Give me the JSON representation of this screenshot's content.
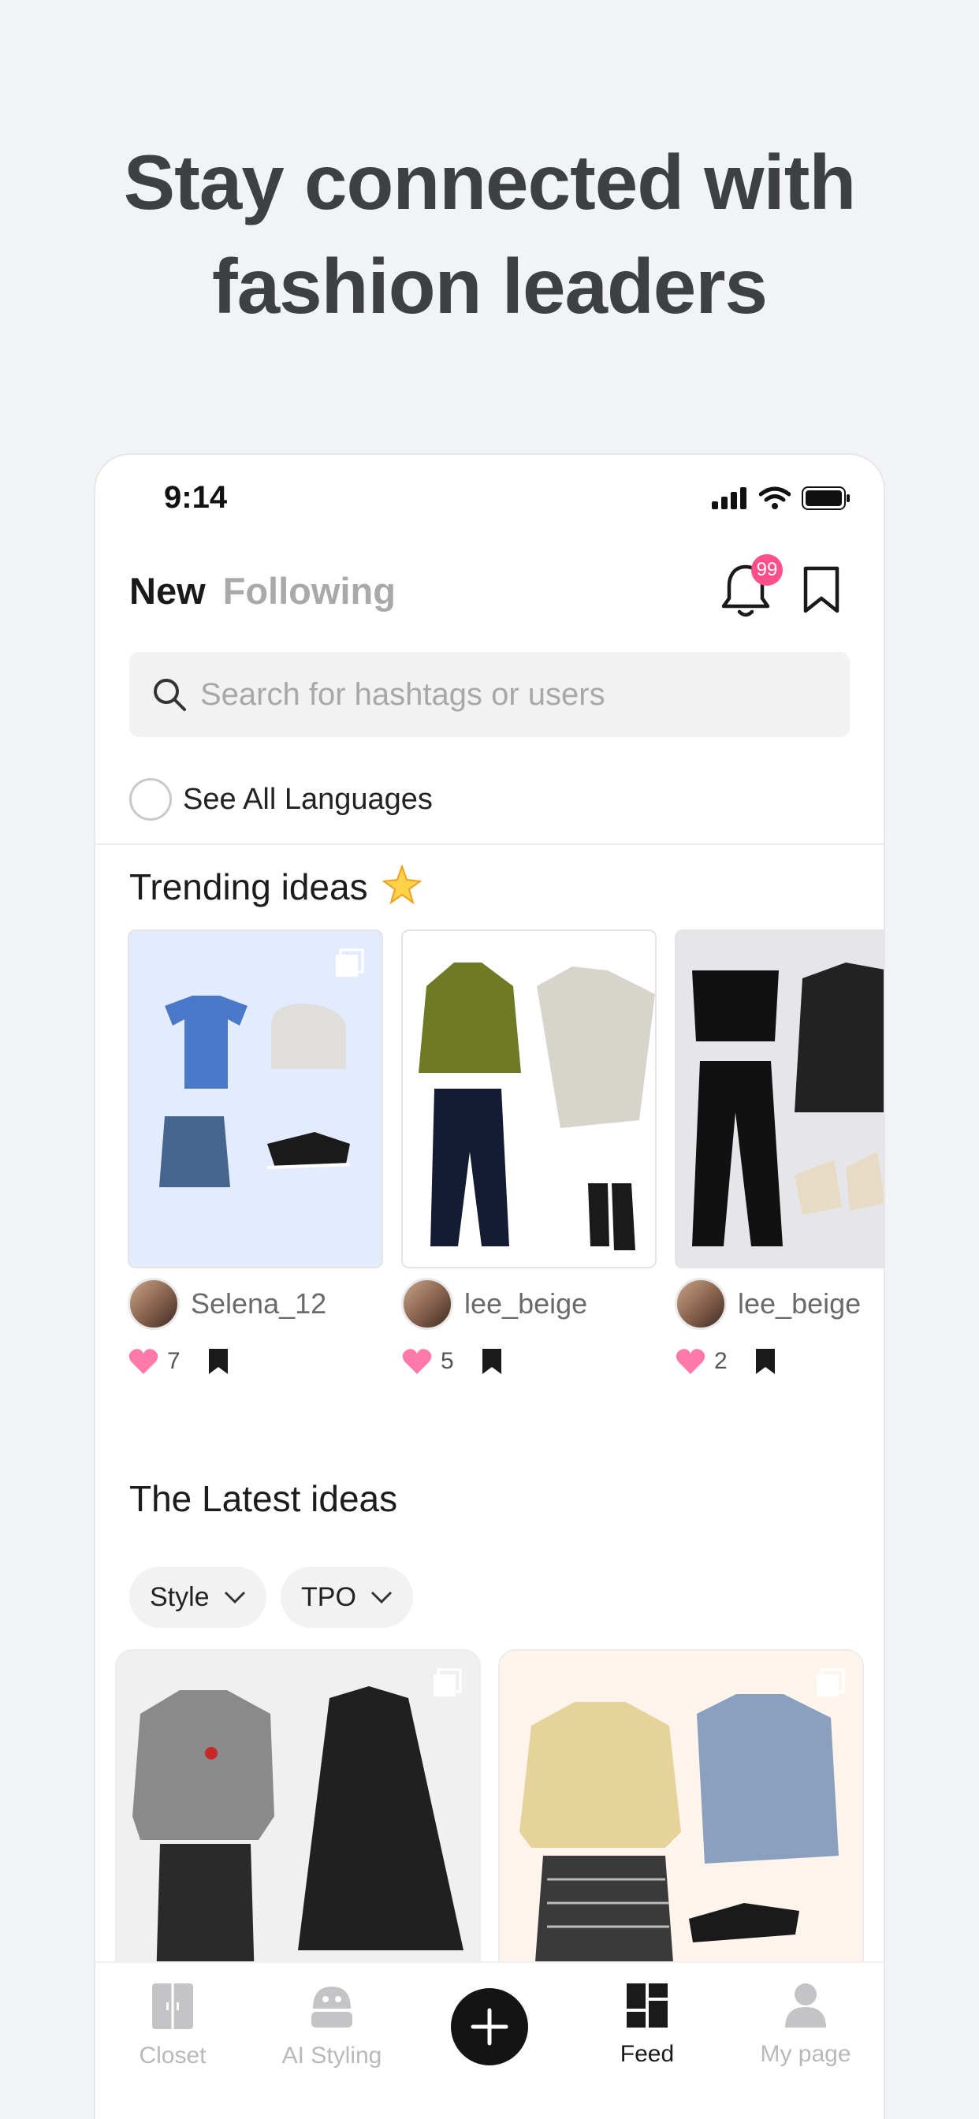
{
  "headline": {
    "line1": "Stay connected with",
    "line2": "fashion leaders"
  },
  "status_bar": {
    "time": "9:14"
  },
  "header": {
    "tab_new": "New",
    "tab_following": "Following",
    "notification_badge": "99"
  },
  "search": {
    "placeholder": "Search for hashtags or users"
  },
  "language_filter": {
    "label": "See All Languages"
  },
  "trending": {
    "title": "Trending ideas",
    "cards": [
      {
        "creator": "Selena_12",
        "likes": "7"
      },
      {
        "creator": "lee_beige",
        "likes": "5"
      },
      {
        "creator": "lee_beige",
        "likes": "2"
      }
    ]
  },
  "latest": {
    "title": "The Latest ideas",
    "filters": [
      {
        "label": "Style"
      },
      {
        "label": "TPO"
      }
    ]
  },
  "tabbar": {
    "items": [
      {
        "label": "Closet"
      },
      {
        "label": "AI Styling"
      },
      {
        "label": "Feed"
      },
      {
        "label": "My page"
      }
    ],
    "active": "Feed"
  },
  "colors": {
    "accent_pink": "#ff4f8b",
    "like_pink": "#ff7aa8",
    "background": "#f2f3f5"
  }
}
